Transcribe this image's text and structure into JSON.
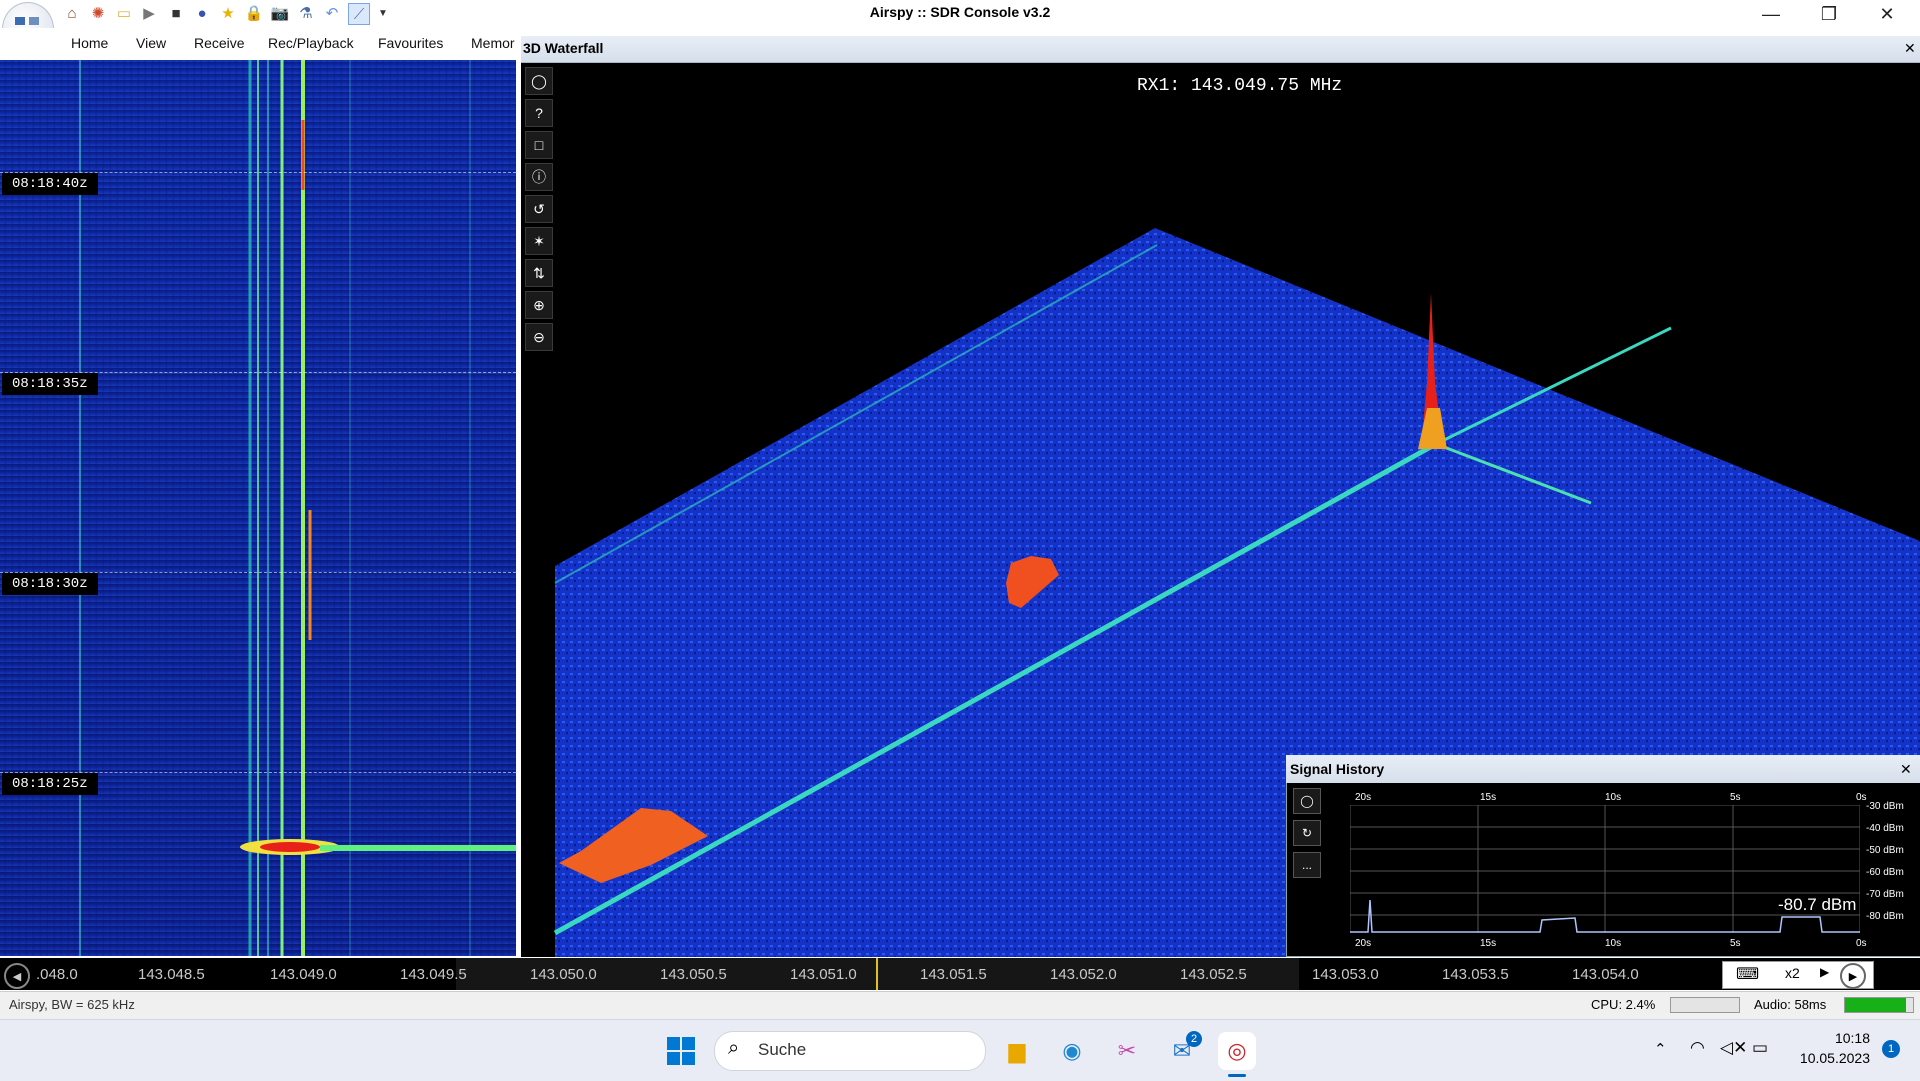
{
  "window": {
    "title": "Airspy :: SDR Console v3.2"
  },
  "ribbon": {
    "tabs": [
      "Home",
      "View",
      "Receive",
      "Rec/Playback",
      "Favourites",
      "Memor"
    ]
  },
  "waterfall_left": {
    "time_labels": [
      "08:18:40z",
      "08:18:35z",
      "08:18:30z",
      "08:18:25z"
    ]
  },
  "waterfall3d": {
    "title": "3D Waterfall",
    "close": "✕",
    "rx_label": "RX1: 143.049.75 MHz",
    "tools": [
      "◯",
      "?",
      "□",
      "ⓘ",
      "↺",
      "✶",
      "⇅",
      "⊕",
      "⊖"
    ]
  },
  "signal_history": {
    "title": "Signal History",
    "close": "✕",
    "buttons": [
      "◯",
      "↻",
      "..."
    ],
    "time_ticks": [
      "20s",
      "15s",
      "10s",
      "5s",
      "0s"
    ],
    "dbm_ticks": [
      "-30 dBm",
      "-40 dBm",
      "-50 dBm",
      "-60 dBm",
      "-70 dBm",
      "-80 dBm"
    ],
    "value": "-80.7 dBm"
  },
  "freq_bar": {
    "labels": [
      ".048.0",
      "143.048.5",
      "143.049.0",
      "143.049.5",
      "143.050.0",
      "143.050.5",
      "143.051.0",
      "143.051.5",
      "143.052.0",
      "143.052.5",
      "143.053.0",
      "143.053.5",
      "143.054.0"
    ],
    "zoom": "x2"
  },
  "status": {
    "left": "Airspy, BW = 625 kHz",
    "cpu": "CPU: 2.4%",
    "audio": "Audio: 58ms",
    "audio_level": 0.9
  },
  "taskbar": {
    "search": "Suche",
    "time": "10:18",
    "date": "10.05.2023",
    "mail_badge": "2",
    "notif_badge": "1"
  },
  "colors": {
    "accent": "#0067c0",
    "spectrum_blue": "#0c2396",
    "signal_red": "#e8201a"
  }
}
